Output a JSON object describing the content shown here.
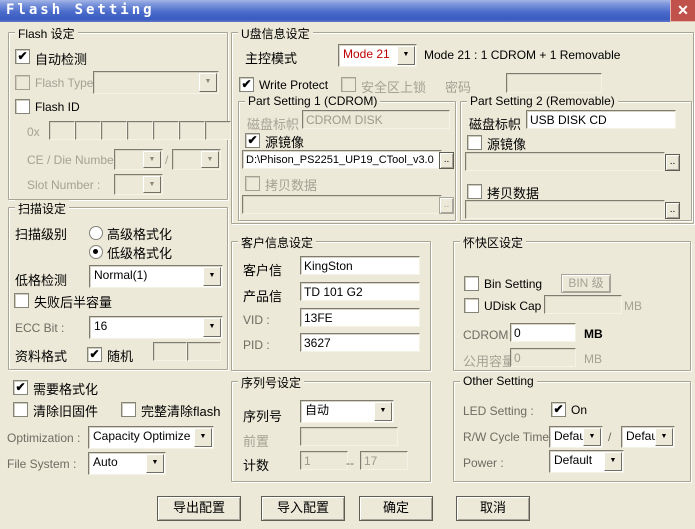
{
  "icons": {
    "dropdown_arrow": "▼",
    "check": "✔",
    "close": "✕"
  },
  "window": {
    "title": "Flash Setting"
  },
  "flash_group": {
    "legend": "Flash 设定",
    "auto_detect": "自动检测",
    "flash_type": "Flash Type",
    "flash_id": "Flash ID",
    "hex_prefix": "0x",
    "ce_die_label": "CE / Die Number :",
    "ce_die_sep": "/",
    "slot_label": "Slot Number :"
  },
  "scan_group": {
    "legend": "扫描设定",
    "level_label": "扫描级别",
    "radio_high": "高级格式化",
    "radio_low": "低级格式化",
    "lowformat_label": "低格检测",
    "lowformat_value": "Normal(1)",
    "half_capacity": "失败后半容量",
    "ecc_label": "ECC Bit :",
    "ecc_value": "16",
    "data_format_label": "资料格式",
    "random_label": "随机"
  },
  "format_opts": {
    "need_format": "需要格式化",
    "clear_old": "清除旧固件",
    "full_clear": "完整清除flash",
    "optimization_label": "Optimization :",
    "optimization_value": "Capacity Optimize",
    "filesystem_label": "File System :",
    "filesystem_value": "Auto"
  },
  "usb_group": {
    "legend": "U盘信息设定",
    "mode_label": "主控模式",
    "mode_value": "Mode 21",
    "mode_desc": "Mode 21 : 1 CDROM + 1 Removable",
    "write_protect": "Write Protect",
    "secure_lock": "安全区上锁",
    "password_label": "密码",
    "browse": "..",
    "part1": {
      "legend": "Part Setting 1 (CDROM)",
      "disk_label": "磁盘标帜",
      "disk_value": "CDROM DISK",
      "source_image": "源镜像",
      "source_path": "D:\\Phison_PS2251_UP19_CTool_v3.0",
      "copy_data": "拷贝数据"
    },
    "part2": {
      "legend": "Part Setting 2 (Removable)",
      "disk_label": "磁盘标帜",
      "disk_value": "USB DISK CD",
      "source_image": "源镜像",
      "copy_data": "拷贝数据"
    }
  },
  "customer_group": {
    "legend": "客户信息设定",
    "customer_label": "客户信",
    "customer_value": "KingSton",
    "product_label": "产品信",
    "product_value": "TD 101 G2",
    "vid_label": "VID :",
    "vid_value": "13FE",
    "pid_label": "PID :",
    "pid_value": "3627"
  },
  "cache_group": {
    "legend": "怀快区设定",
    "bin_setting": "Bin Setting",
    "bin_button": "BIN 级",
    "udisk_cap": "UDisk Cap",
    "udisk_unit": "MB",
    "cdrom_label": "CDROM :",
    "cdrom_value": "0",
    "cdrom_unit": "MB",
    "public_label": "公用容量",
    "public_value": "0",
    "public_unit": "MB"
  },
  "serial_group": {
    "legend": "序列号设定",
    "serial_label": "序列号",
    "serial_value": "自动",
    "prefix_label": "前置",
    "count_label": "计数",
    "count_from": "1",
    "count_sep": "--",
    "count_to": "17"
  },
  "other_group": {
    "legend": "Other Setting",
    "led_label": "LED Setting :",
    "led_on": "On",
    "rw_label": "R/W Cycle Time:",
    "rw_value1": "Defau",
    "rw_sep": "/",
    "rw_value2": "Defau",
    "power_label": "Power :",
    "power_value": "Default"
  },
  "buttons": {
    "export": "导出配置",
    "import": "导入配置",
    "ok": "确定",
    "cancel": "取消"
  }
}
